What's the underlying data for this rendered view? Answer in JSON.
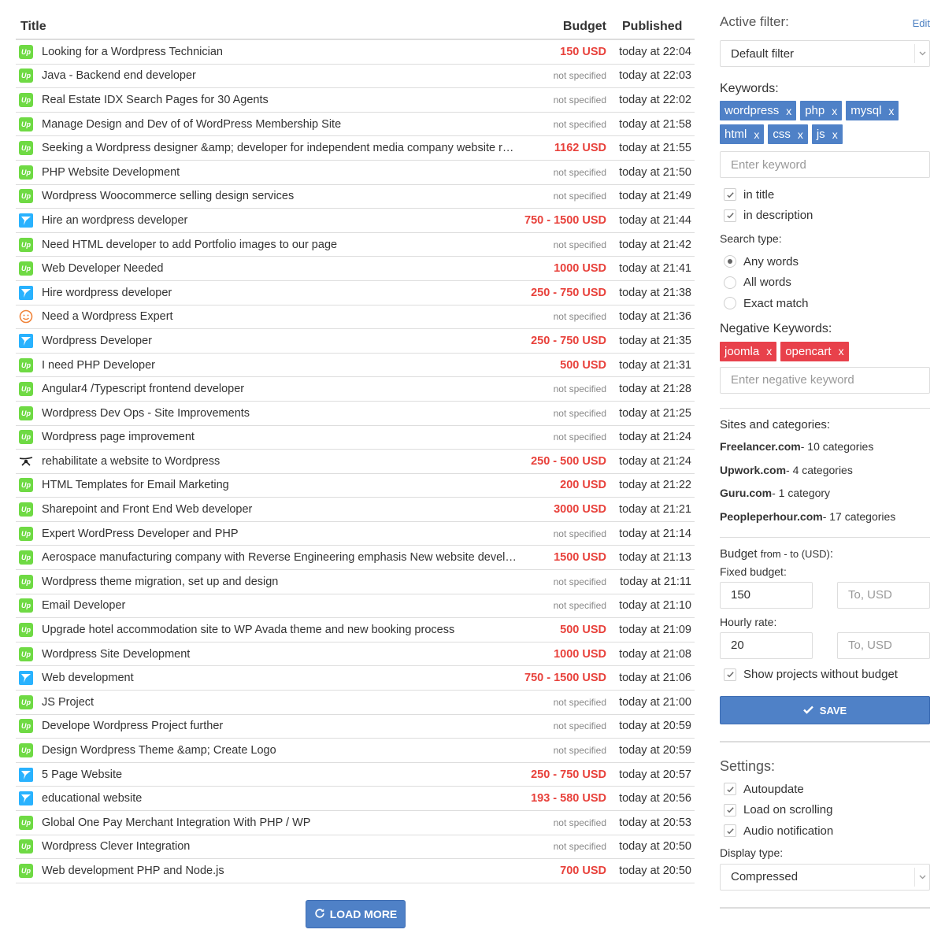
{
  "table": {
    "headers": {
      "title": "Title",
      "budget": "Budget",
      "published": "Published"
    },
    "rows": [
      {
        "site": "upwork",
        "title": "Looking for a Wordpress Technician",
        "budget": "150 USD",
        "specified": true,
        "published": "today at 22:04"
      },
      {
        "site": "upwork",
        "title": "Java - Backend end developer",
        "budget": "not specified",
        "specified": false,
        "published": "today at 22:03"
      },
      {
        "site": "upwork",
        "title": "Real Estate IDX Search Pages for 30 Agents",
        "budget": "not specified",
        "specified": false,
        "published": "today at 22:02"
      },
      {
        "site": "upwork",
        "title": "Manage Design and Dev of of WordPress Membership Site",
        "budget": "not specified",
        "specified": false,
        "published": "today at 21:58"
      },
      {
        "site": "upwork",
        "title": "Seeking a Wordpress designer &amp; developer for independent media company website redesign",
        "budget": "1162 USD",
        "specified": true,
        "published": "today at 21:55"
      },
      {
        "site": "upwork",
        "title": "PHP Website Development",
        "budget": "not specified",
        "specified": false,
        "published": "today at 21:50"
      },
      {
        "site": "upwork",
        "title": "Wordpress Woocommerce selling design services",
        "budget": "not specified",
        "specified": false,
        "published": "today at 21:49"
      },
      {
        "site": "freelancer",
        "title": "Hire an wordpress developer",
        "budget": "750 - 1500 USD",
        "specified": true,
        "published": "today at 21:44"
      },
      {
        "site": "upwork",
        "title": "Need HTML developer to add Portfolio images to our page",
        "budget": "not specified",
        "specified": false,
        "published": "today at 21:42"
      },
      {
        "site": "upwork",
        "title": "Web Developer Needed",
        "budget": "1000 USD",
        "specified": true,
        "published": "today at 21:41"
      },
      {
        "site": "freelancer",
        "title": "Hire wordpress developer",
        "budget": "250 - 750 USD",
        "specified": true,
        "published": "today at 21:38"
      },
      {
        "site": "pph",
        "title": "Need a Wordpress Expert",
        "budget": "not specified",
        "specified": false,
        "published": "today at 21:36"
      },
      {
        "site": "freelancer",
        "title": "Wordpress Developer",
        "budget": "250 - 750 USD",
        "specified": true,
        "published": "today at 21:35"
      },
      {
        "site": "upwork",
        "title": "I need PHP Developer",
        "budget": "500 USD",
        "specified": true,
        "published": "today at 21:31"
      },
      {
        "site": "upwork",
        "title": "Angular4 /Typescript frontend developer",
        "budget": "not specified",
        "specified": false,
        "published": "today at 21:28"
      },
      {
        "site": "upwork",
        "title": "Wordpress Dev Ops - Site Improvements",
        "budget": "not specified",
        "specified": false,
        "published": "today at 21:25"
      },
      {
        "site": "upwork",
        "title": "Wordpress page improvement",
        "budget": "not specified",
        "specified": false,
        "published": "today at 21:24"
      },
      {
        "site": "guru",
        "title": "rehabilitate a website to Wordpress",
        "budget": "250 - 500 USD",
        "specified": true,
        "published": "today at 21:24"
      },
      {
        "site": "upwork",
        "title": "HTML Templates for Email Marketing",
        "budget": "200 USD",
        "specified": true,
        "published": "today at 21:22"
      },
      {
        "site": "upwork",
        "title": "Sharepoint and Front End Web developer",
        "budget": "3000 USD",
        "specified": true,
        "published": "today at 21:21"
      },
      {
        "site": "upwork",
        "title": "Expert WordPress Developer and PHP",
        "budget": "not specified",
        "specified": false,
        "published": "today at 21:14"
      },
      {
        "site": "upwork",
        "title": "Aerospace manufacturing company with Reverse Engineering emphasis New website development",
        "budget": "1500 USD",
        "specified": true,
        "published": "today at 21:13"
      },
      {
        "site": "upwork",
        "title": "Wordpress theme migration, set up and design",
        "budget": "not specified",
        "specified": false,
        "published": "today at 21:11"
      },
      {
        "site": "upwork",
        "title": "Email Developer",
        "budget": "not specified",
        "specified": false,
        "published": "today at 21:10"
      },
      {
        "site": "upwork",
        "title": "Upgrade hotel accommodation site to WP Avada theme and new booking process",
        "budget": "500 USD",
        "specified": true,
        "published": "today at 21:09"
      },
      {
        "site": "upwork",
        "title": "Wordpress Site Development",
        "budget": "1000 USD",
        "specified": true,
        "published": "today at 21:08"
      },
      {
        "site": "freelancer",
        "title": "Web development",
        "budget": "750 - 1500 USD",
        "specified": true,
        "published": "today at 21:06"
      },
      {
        "site": "upwork",
        "title": "JS Project",
        "budget": "not specified",
        "specified": false,
        "published": "today at 21:00"
      },
      {
        "site": "upwork",
        "title": "Develope Wordpress Project further",
        "budget": "not specified",
        "specified": false,
        "published": "today at 20:59"
      },
      {
        "site": "upwork",
        "title": "Design Wordpress Theme &amp; Create Logo",
        "budget": "not specified",
        "specified": false,
        "published": "today at 20:59"
      },
      {
        "site": "freelancer",
        "title": "5 Page Website",
        "budget": "250 - 750 USD",
        "specified": true,
        "published": "today at 20:57"
      },
      {
        "site": "freelancer",
        "title": "educational website",
        "budget": "193 - 580 USD",
        "specified": true,
        "published": "today at 20:56"
      },
      {
        "site": "upwork",
        "title": "Global One Pay Merchant Integration With PHP / WP",
        "budget": "not specified",
        "specified": false,
        "published": "today at 20:53"
      },
      {
        "site": "upwork",
        "title": "Wordpress Clever Integration",
        "budget": "not specified",
        "specified": false,
        "published": "today at 20:50"
      },
      {
        "site": "upwork",
        "title": "Web development PHP and Node.js",
        "budget": "700 USD",
        "specified": true,
        "published": "today at 20:50"
      }
    ],
    "load_more_label": "LOAD MORE"
  },
  "sidebar": {
    "active_filter_label": "Active filter:",
    "edit_label": "Edit",
    "active_filter_value": "Default filter",
    "keywords_label": "Keywords:",
    "keywords": [
      "wordpress",
      "php",
      "mysql",
      "html",
      "css",
      "js"
    ],
    "keyword_placeholder": "Enter keyword",
    "in_title_label": "in title",
    "in_title_checked": true,
    "in_description_label": "in description",
    "in_description_checked": true,
    "search_type_label": "Search type:",
    "search_types": [
      {
        "label": "Any words",
        "selected": true
      },
      {
        "label": "All words",
        "selected": false
      },
      {
        "label": "Exact match",
        "selected": false
      }
    ],
    "negative_keywords_label": "Negative Keywords:",
    "negative_keywords": [
      "joomla",
      "opencart"
    ],
    "negative_keyword_placeholder": "Enter negative keyword",
    "sites_label": "Sites and categories:",
    "sites": [
      {
        "name": "Freelancer.com",
        "detail": " - 10 categories"
      },
      {
        "name": "Upwork.com",
        "detail": " - 4 categories"
      },
      {
        "name": "Guru.com",
        "detail": " - 1 category"
      },
      {
        "name": "Peopleperhour.com",
        "detail": " - 17 categories"
      }
    ],
    "budget_label": "Budget",
    "budget_sub": "from - to (USD)",
    "budget_colon": ":",
    "fixed_budget_label": "Fixed budget:",
    "fixed_from": "150",
    "fixed_to_placeholder": "To, USD",
    "hourly_rate_label": "Hourly rate:",
    "hourly_from": "20",
    "hourly_to_placeholder": "To, USD",
    "show_without_budget_label": "Show projects without budget",
    "show_without_budget_checked": true,
    "save_label": "SAVE",
    "settings_label": "Settings:",
    "autoupdate_label": "Autoupdate",
    "load_on_scrolling_label": "Load on scrolling",
    "audio_notification_label": "Audio notification",
    "display_type_label": "Display type:",
    "display_type_value": "Compressed"
  },
  "colors": {
    "accent_blue": "#4f81c7",
    "price_red": "#e8413b",
    "negative_tag_red": "#e8414b",
    "upwork_green": "#6fda44",
    "freelancer_blue": "#29b2fe"
  }
}
